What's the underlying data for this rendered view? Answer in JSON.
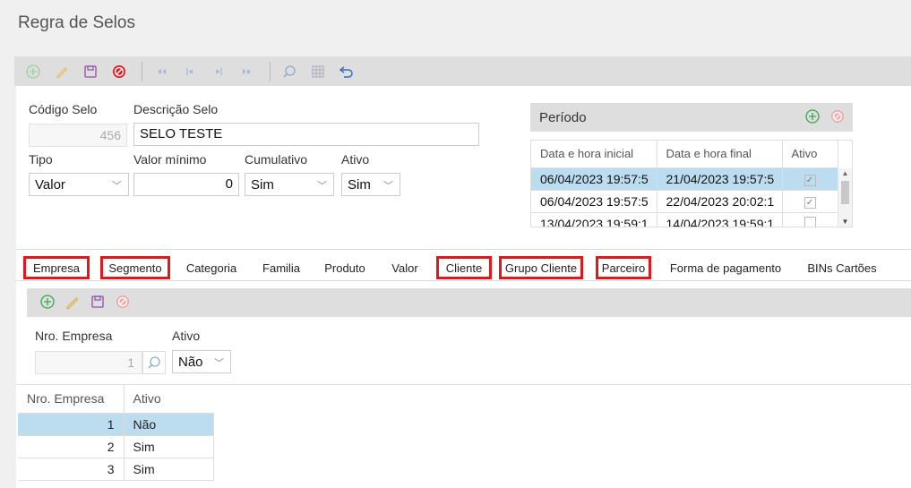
{
  "title": "Regra de Selos",
  "toolbar": {
    "icons": [
      "add-icon",
      "edit-icon",
      "save-icon",
      "cancel-icon",
      "first-icon",
      "prev-icon",
      "next-icon",
      "last-icon",
      "search-icon",
      "grid-icon",
      "undo-icon"
    ]
  },
  "form": {
    "codigo_label": "Código Selo",
    "codigo_value": "456",
    "descricao_label": "Descrição Selo",
    "descricao_value": "SELO TESTE",
    "tipo_label": "Tipo",
    "tipo_value": "Valor",
    "valor_minimo_label": "Valor mínimo",
    "valor_minimo_value": "0",
    "cumulativo_label": "Cumulativo",
    "cumulativo_value": "Sim",
    "ativo_label": "Ativo",
    "ativo_value": "Sim"
  },
  "periodo": {
    "title": "Período",
    "headers": [
      "Data e hora inicial",
      "Data e hora final",
      "Ativo"
    ],
    "rows": [
      {
        "inicio": "06/04/2023 19:57:5",
        "fim": "21/04/2023 19:57:5",
        "ativo": true
      },
      {
        "inicio": "06/04/2023 19:57:5",
        "fim": "22/04/2023 20:02:1",
        "ativo": true
      },
      {
        "inicio": "13/04/2023 19:59:1",
        "fim": "14/04/2023 19:59:1",
        "ativo": false
      }
    ]
  },
  "tabs": [
    "Empresa",
    "Segmento",
    "Categoria",
    "Familia",
    "Produto",
    "Valor",
    "Cliente",
    "Grupo Cliente",
    "Parceiro",
    "Forma de pagamento",
    "BINs Cartões"
  ],
  "empresa_form": {
    "nro_label": "Nro. Empresa",
    "nro_value": "1",
    "ativo_label": "Ativo",
    "ativo_value": "Não"
  },
  "empresa_grid": {
    "headers": [
      "Nro. Empresa",
      "Ativo"
    ],
    "rows": [
      {
        "nro": "1",
        "ativo": "Não"
      },
      {
        "nro": "2",
        "ativo": "Sim"
      },
      {
        "nro": "3",
        "ativo": "Sim"
      }
    ]
  },
  "colors": {
    "accent": "#1a8cd8",
    "highlight": "#e0181c",
    "selected_row": "#bcdcf0"
  }
}
